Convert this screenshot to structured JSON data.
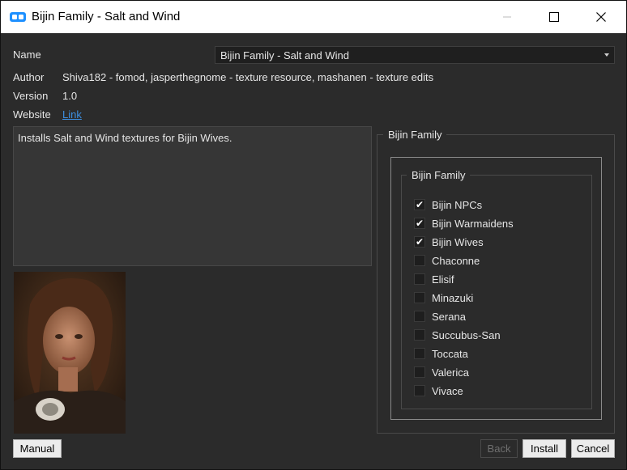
{
  "window": {
    "title": "Bijin Family - Salt and Wind"
  },
  "form": {
    "name_label": "Name",
    "name_value": "Bijin Family - Salt and Wind",
    "author_label": "Author",
    "author_value": "Shiva182 - fomod, jasperthegnome - texture resource, mashanen - texture edits",
    "version_label": "Version",
    "version_value": "1.0",
    "website_label": "Website",
    "website_link": "Link"
  },
  "description": "Installs Salt and Wind textures for Bijin Wives.",
  "group_outer_title": "Bijin Family",
  "group_inner_title": "Bijin Family",
  "options": [
    {
      "label": "Bijin NPCs",
      "checked": true
    },
    {
      "label": "Bijin Warmaidens",
      "checked": true
    },
    {
      "label": "Bijin Wives",
      "checked": true
    },
    {
      "label": "Chaconne",
      "checked": false
    },
    {
      "label": "Elisif",
      "checked": false
    },
    {
      "label": "Minazuki",
      "checked": false
    },
    {
      "label": "Serana",
      "checked": false
    },
    {
      "label": "Succubus-San",
      "checked": false
    },
    {
      "label": "Toccata",
      "checked": false
    },
    {
      "label": "Valerica",
      "checked": false
    },
    {
      "label": "Vivace",
      "checked": false
    }
  ],
  "buttons": {
    "manual": "Manual",
    "back": "Back",
    "install": "Install",
    "cancel": "Cancel"
  },
  "colors": {
    "link": "#3d8fe0",
    "accent_icon": "#1e90ff"
  }
}
